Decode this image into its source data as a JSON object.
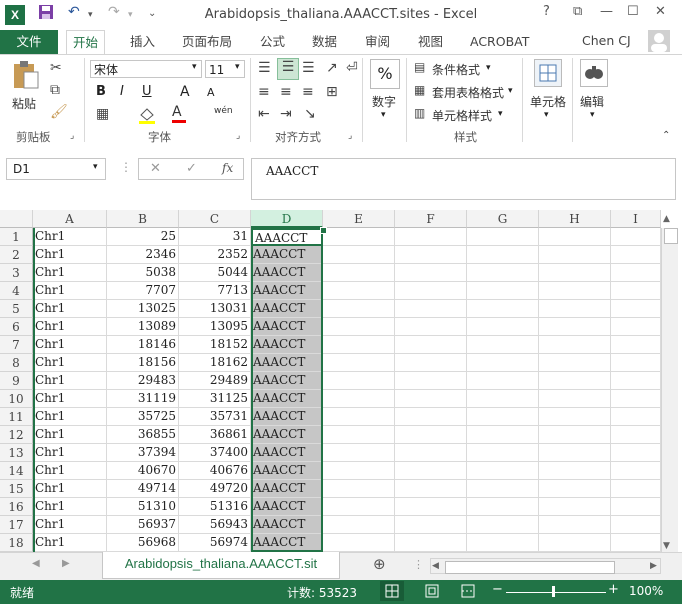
{
  "window": {
    "title": "Arabidopsis_thaliana.AAACCT.sites - Excel",
    "help": "?",
    "minimize": "—",
    "restore": "☐",
    "close": "✕",
    "app_logo": "X"
  },
  "qat": {
    "undo": "↶",
    "redo": "↷",
    "more": "⌄"
  },
  "tabs": [
    "文件",
    "开始",
    "插入",
    "页面布局",
    "公式",
    "数据",
    "审阅",
    "视图",
    "ACROBAT"
  ],
  "user": "Chen CJ",
  "ribbon": {
    "clipboard": {
      "paste": "粘贴",
      "label": "剪贴板"
    },
    "font": {
      "name": "宋体",
      "size": "11",
      "label": "字体",
      "bold": "B",
      "italic": "I",
      "underline": "U",
      "grow": "A",
      "shrink": "A",
      "wen": "wén"
    },
    "alignment": {
      "label": "对齐方式"
    },
    "number": {
      "big": "%",
      "label": "数字"
    },
    "styles": {
      "conditional": "条件格式",
      "table": "套用表格格式",
      "cell": "单元格样式",
      "label": "样式"
    },
    "cells": {
      "label": "单元格"
    },
    "editing": {
      "label": "编辑"
    }
  },
  "formula_bar": {
    "name_box": "D1",
    "cancel": "✕",
    "enter": "✓",
    "fx": "fx",
    "value": "AAACCT"
  },
  "columns": [
    "A",
    "B",
    "C",
    "D",
    "E",
    "F",
    "G",
    "H",
    "I"
  ],
  "rows": [
    [
      "1",
      "Chr1",
      "25",
      "31",
      "AAACCT"
    ],
    [
      "2",
      "Chr1",
      "2346",
      "2352",
      "AAACCT"
    ],
    [
      "3",
      "Chr1",
      "5038",
      "5044",
      "AAACCT"
    ],
    [
      "4",
      "Chr1",
      "7707",
      "7713",
      "AAACCT"
    ],
    [
      "5",
      "Chr1",
      "13025",
      "13031",
      "AAACCT"
    ],
    [
      "6",
      "Chr1",
      "13089",
      "13095",
      "AAACCT"
    ],
    [
      "7",
      "Chr1",
      "18146",
      "18152",
      "AAACCT"
    ],
    [
      "8",
      "Chr1",
      "18156",
      "18162",
      "AAACCT"
    ],
    [
      "9",
      "Chr1",
      "29483",
      "29489",
      "AAACCT"
    ],
    [
      "10",
      "Chr1",
      "31119",
      "31125",
      "AAACCT"
    ],
    [
      "11",
      "Chr1",
      "35725",
      "35731",
      "AAACCT"
    ],
    [
      "12",
      "Chr1",
      "36855",
      "36861",
      "AAACCT"
    ],
    [
      "13",
      "Chr1",
      "37394",
      "37400",
      "AAACCT"
    ],
    [
      "14",
      "Chr1",
      "40670",
      "40676",
      "AAACCT"
    ],
    [
      "15",
      "Chr1",
      "49714",
      "49720",
      "AAACCT"
    ],
    [
      "16",
      "Chr1",
      "51310",
      "51316",
      "AAACCT"
    ],
    [
      "17",
      "Chr1",
      "56937",
      "56943",
      "AAACCT"
    ],
    [
      "18",
      "Chr1",
      "56968",
      "56974",
      "AAACCT"
    ]
  ],
  "sheet_tab": "Arabidopsis_thaliana.AAACCT.sit",
  "add_sheet": "⊕",
  "status": {
    "ready": "就绪",
    "count": "计数: 53523",
    "zoom": "100%",
    "minus": "−",
    "plus": "+"
  },
  "colors": {
    "accent": "#217346",
    "selected_col": "#c6c6c6"
  }
}
